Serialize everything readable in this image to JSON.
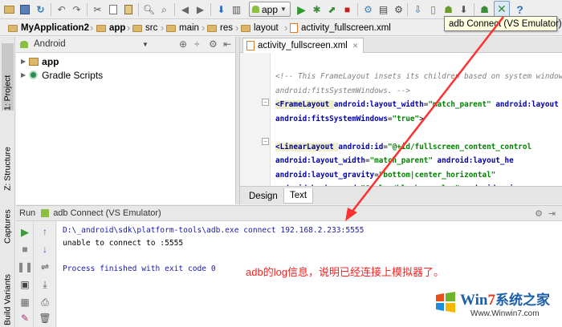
{
  "tooltip": {
    "text": "adb Connect (VS Emulator)"
  },
  "toolbar": {
    "run_config": "app"
  },
  "breadcrumb": [
    "MyApplication2",
    "app",
    "src",
    "main",
    "res",
    "layout",
    "activity_fullscreen.xml"
  ],
  "left_strip": {
    "project_tab": "1: Project",
    "structure_tab": "Z: Structure",
    "captures_tab": "Captures",
    "build_variants_tab": "Build Variants"
  },
  "project_panel": {
    "view_mode": "Android",
    "tree": [
      {
        "label": "app",
        "expanded": false
      },
      {
        "label": "Gradle Scripts",
        "expanded": false
      }
    ]
  },
  "editor": {
    "file_tab": "activity_fullscreen.xml",
    "lines": [
      {
        "segments": [
          {
            "cls": "cm",
            "text": "<!-- This FrameLayout insets its children based on system windows usin"
          }
        ]
      },
      {
        "segments": [
          {
            "cls": "cm",
            "text": "      android:fitsSystemWindows. -->"
          }
        ]
      },
      {
        "segments": [
          {
            "cls": "tag",
            "text": "<FrameLayout "
          },
          {
            "cls": "attr",
            "text": "android:layout_width"
          },
          {
            "cls": "",
            "text": "="
          },
          {
            "cls": "str",
            "text": "\"match_parent\""
          },
          {
            "cls": "",
            "text": " "
          },
          {
            "cls": "attr",
            "text": "android:layout"
          }
        ]
      },
      {
        "segments": [
          {
            "cls": "",
            "text": "    "
          },
          {
            "cls": "attr",
            "text": "android:fitsSystemWindows"
          },
          {
            "cls": "",
            "text": "="
          },
          {
            "cls": "str",
            "text": "\"true\""
          },
          {
            "cls": "",
            "text": ">"
          }
        ]
      },
      {
        "segments": [
          {
            "cls": "",
            "text": ""
          }
        ]
      },
      {
        "segments": [
          {
            "cls": "",
            "text": "    "
          },
          {
            "cls": "tag",
            "text": "<LinearLayout "
          },
          {
            "cls": "attr",
            "text": "android:id"
          },
          {
            "cls": "",
            "text": "="
          },
          {
            "cls": "str",
            "text": "\"@+id/fullscreen_content_control"
          }
        ]
      },
      {
        "segments": [
          {
            "cls": "",
            "text": "        "
          },
          {
            "cls": "attr",
            "text": "android:layout_width"
          },
          {
            "cls": "",
            "text": "="
          },
          {
            "cls": "str",
            "text": "\"match_parent\""
          },
          {
            "cls": "",
            "text": " "
          },
          {
            "cls": "attr",
            "text": "android:layout_he"
          }
        ]
      },
      {
        "segments": [
          {
            "cls": "",
            "text": "        "
          },
          {
            "cls": "attr",
            "text": "android:layout_gravity"
          },
          {
            "cls": "",
            "text": "="
          },
          {
            "cls": "str",
            "text": "\"bottom|center_horizontal\""
          }
        ]
      },
      {
        "segments": [
          {
            "cls": "",
            "text": "        "
          },
          {
            "cls": "attr",
            "text": "android:background"
          },
          {
            "cls": "",
            "text": "="
          },
          {
            "cls": "str",
            "text": "\"@color/black_overlay\""
          },
          {
            "cls": "",
            "text": " "
          },
          {
            "cls": "attr",
            "text": "android:ori"
          }
        ]
      }
    ],
    "design_tab": "Design",
    "text_tab": "Text"
  },
  "run_panel": {
    "title_prefix": "Run",
    "title": "adb Connect (VS Emulator)",
    "console": [
      {
        "text": "D:\\_android\\sdk\\platform-tools\\adb.exe connect 192.168.2.233:5555",
        "color": "#1a1aa6"
      },
      {
        "text": "unable to connect to :5555",
        "color": "#000000"
      },
      {
        "text": "",
        "color": "#000000"
      },
      {
        "text": "Process finished with exit code 0",
        "color": "#1a1aa6"
      }
    ]
  },
  "annotation": "adb的log信息，说明已经连接上模拟器了。",
  "watermark": {
    "brand_prefix": "Win",
    "brand_digit": "7",
    "brand_suffix": "系统之家",
    "url": "Www.Winwin7.com"
  },
  "colors": {
    "annotation": "#ff2020",
    "arrow": "#ff3030",
    "run_green": "#3c9a3c"
  }
}
